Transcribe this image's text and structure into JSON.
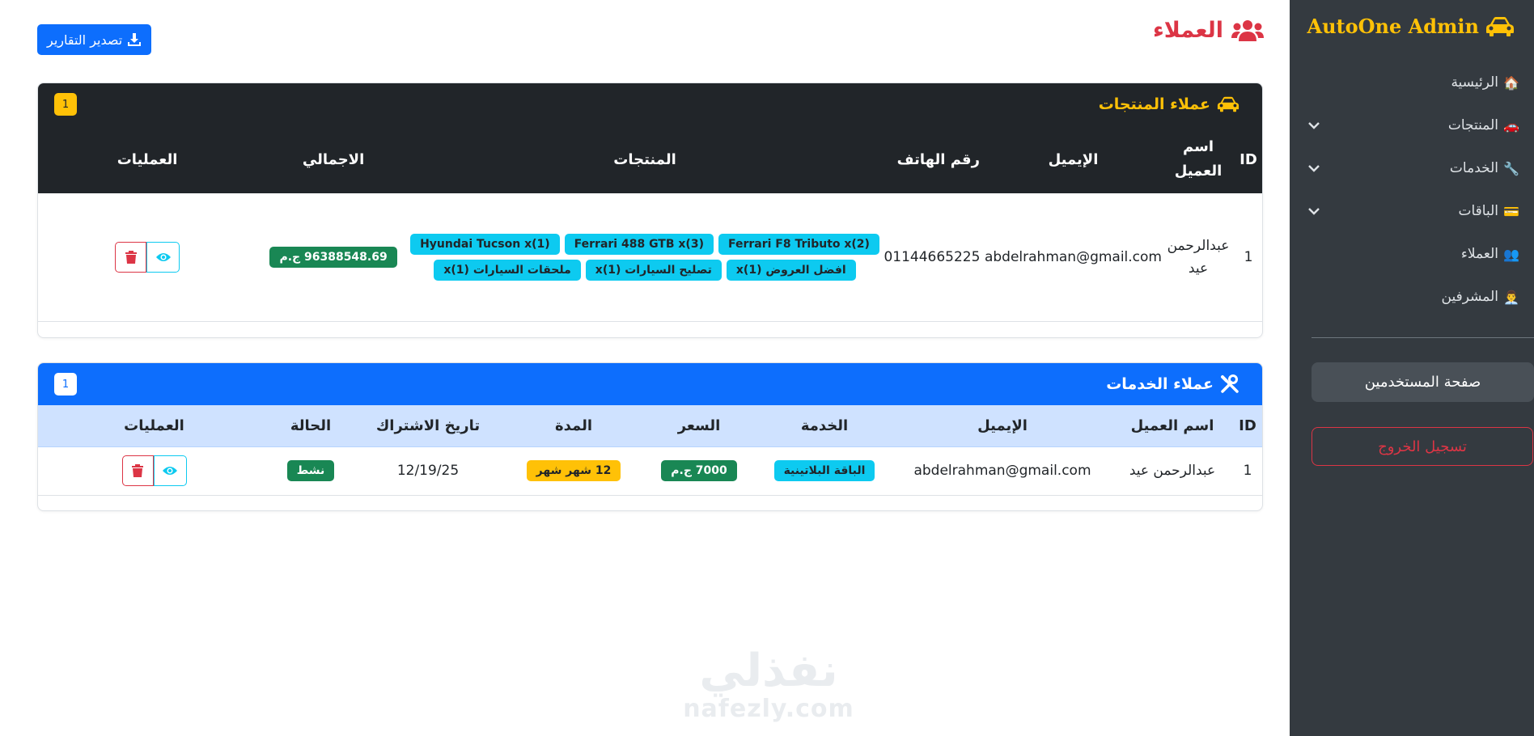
{
  "sidebar": {
    "brand": "AutoOne Admin",
    "brand_icon": "car-icon",
    "items": [
      {
        "label": "الرئيسية",
        "icon": "🏠",
        "has_submenu": false
      },
      {
        "label": "المنتجات",
        "icon": "🚗",
        "has_submenu": true
      },
      {
        "label": "الخدمات",
        "icon": "🔧",
        "has_submenu": true
      },
      {
        "label": "الباقات",
        "icon": "💳",
        "has_submenu": true
      },
      {
        "label": "العملاء",
        "icon": "👥",
        "has_submenu": false
      },
      {
        "label": "المشرفين",
        "icon": "👨‍💼",
        "has_submenu": false
      }
    ],
    "users_page_label": "صفحة المستخدمين",
    "logout_label": "تسجيل الخروج"
  },
  "header": {
    "title": "العملاء",
    "export_label": "تصدير التقارير"
  },
  "products_card": {
    "title": "عملاء المنتجات",
    "count": "1",
    "columns": [
      "ID",
      "اسم العميل",
      "الإيميل",
      "رقم الهاتف",
      "المنتجات",
      "الاجمالي",
      "العمليات"
    ],
    "rows": [
      {
        "id": "1",
        "name": "عبدالرحمن عيد",
        "email": "abdelrahman@gmail.com",
        "phone": "01144665225",
        "products_line1": [
          "Ferrari F8 Tributo x(2)",
          "Ferrari 488 GTB x(3)",
          "Hyundai Tucson x(1)"
        ],
        "products_line2": [
          "افضل العروض (1)x",
          "تصليح السيارات (1)x",
          "ملحقات السيارات (1)x"
        ],
        "total": "96388548.69 ج.م"
      }
    ]
  },
  "services_card": {
    "title": "عملاء الخدمات",
    "count": "1",
    "columns": [
      "ID",
      "اسم العميل",
      "الإيميل",
      "الخدمة",
      "السعر",
      "المدة",
      "تاريخ الاشتراك",
      "الحالة",
      "العمليات"
    ],
    "rows": [
      {
        "id": "1",
        "name": "عبدالرحمن عيد",
        "email": "abdelrahman@gmail.com",
        "service": "الباقة البلاتينية",
        "price": "7000 ج.م",
        "duration": "12 شهر شهر",
        "date": "12/19/25",
        "status": "نشط"
      }
    ]
  },
  "watermark": {
    "text_ar": "نفذلي",
    "text_en": "nafezly.com"
  },
  "colors": {
    "sidebar_bg": "#343a40",
    "brand": "#ffc107",
    "title": "#dc3545",
    "primary": "#0d6efd",
    "dark_header": "#212529",
    "services_thead": "#cfe2ff",
    "cyan": "#0dcaf0",
    "success": "#198754",
    "warning": "#ffc107",
    "danger": "#dc3545"
  }
}
